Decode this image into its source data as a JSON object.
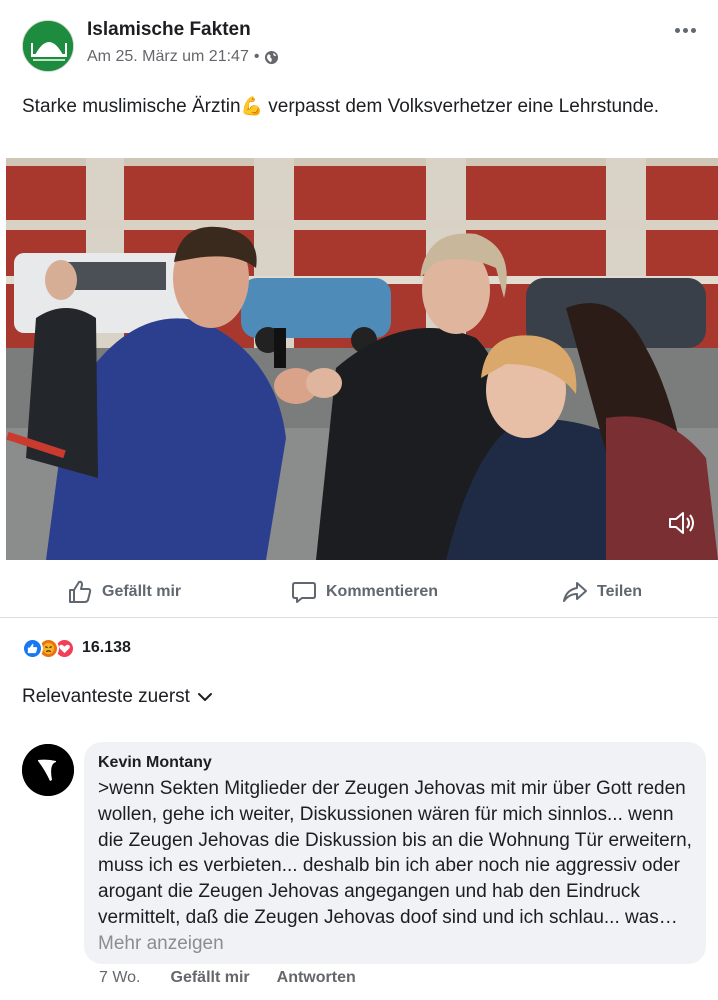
{
  "post": {
    "page_name": "Islamische Fakten",
    "timestamp": "Am 25. März um 21:47",
    "separator": "•",
    "privacy_icon": "globe-icon",
    "more_icon": "more-options-icon",
    "text_before_emoji": "Starke muslimische Ärztin",
    "emoji": "💪",
    "text_after_emoji": " verpasst dem Volksverhetzer eine Lehrstunde."
  },
  "video": {
    "description": "video-player",
    "mute_icon": "speaker-muted-icon"
  },
  "actions": {
    "like_label": "Gefällt mir",
    "comment_label": "Kommentieren",
    "share_label": "Teilen"
  },
  "reactions": {
    "types": [
      "like",
      "angry",
      "love"
    ],
    "count": "16.138"
  },
  "comments_section": {
    "sort_label": "Relevanteste zuerst"
  },
  "comment": {
    "author": "Kevin Montany",
    "text": ">wenn Sekten Mitglieder der Zeugen Jehovas mit mir über Gott reden wollen, gehe ich weiter, Diskussionen wären für mich sinnlos... wenn die Zeugen Jehovas die Diskussion bis an die Wohnung Tür erweitern, muss ich es verbieten... deshalb bin ich aber noch nie aggressiv oder arogant die Zeugen Jehovas angegangen und hab den Eindruck vermittelt, daß die Zeugen Jehovas doof sind und ich schlau... was…",
    "see_more": "Mehr anzeigen",
    "age": "7 Wo.",
    "like_label": "Gefällt mir",
    "reply_label": "Antworten"
  },
  "colors": {
    "brand_blue": "#1877f2",
    "text_primary": "#1c1e21",
    "text_secondary": "#65676b",
    "bubble_bg": "#f0f2f5"
  }
}
